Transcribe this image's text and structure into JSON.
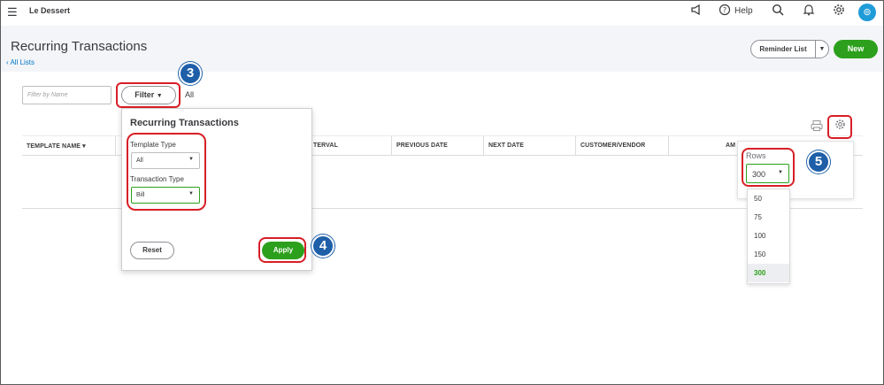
{
  "topbar": {
    "company_name": "Le Dessert",
    "help_label": "Help",
    "avatar_glyph": "⊚"
  },
  "header": {
    "title": "Recurring Transactions",
    "back_link": "All Lists",
    "reminder_button": "Reminder List",
    "new_button": "New"
  },
  "filters": {
    "search_placeholder": "Filter by Name",
    "filter_button": "Filter",
    "filter_summary": "All"
  },
  "table": {
    "columns": [
      "TEMPLATE NAME",
      "TERVAL",
      "PREVIOUS DATE",
      "NEXT DATE",
      "CUSTOMER/VENDOR",
      "AM"
    ]
  },
  "filter_popover": {
    "title": "Recurring Transactions",
    "template_type_label": "Template Type",
    "template_type_value": "All",
    "transaction_type_label": "Transaction Type",
    "transaction_type_value": "Bill",
    "reset_button": "Reset",
    "apply_button": "Apply"
  },
  "rows_settings": {
    "label": "Rows",
    "selected_value": "300",
    "options": [
      "50",
      "75",
      "100",
      "150",
      "300"
    ]
  },
  "annotations": {
    "step_3": "3",
    "step_4": "4",
    "step_5": "5",
    "highlight_color": "#d71f26",
    "badge_color": "#1e5fa8"
  },
  "colors": {
    "accent_green": "#2ca01c",
    "link_blue": "#0077c5"
  }
}
